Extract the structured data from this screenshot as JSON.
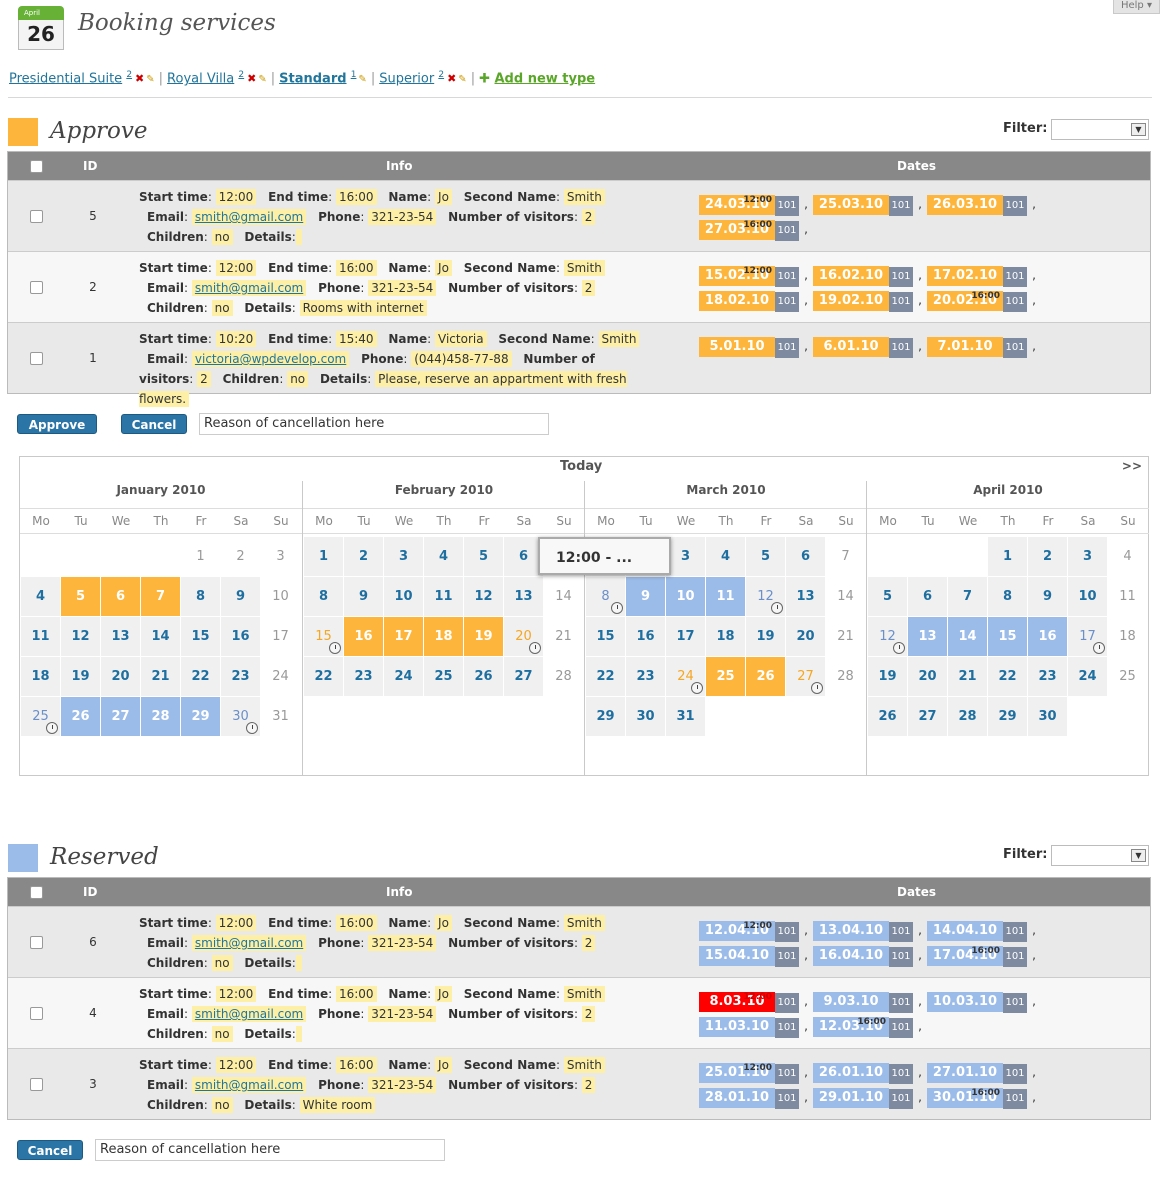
{
  "help": "Help",
  "header": {
    "logo_month": "April",
    "logo_day": "26",
    "title": "Booking services"
  },
  "types": [
    {
      "label": "Presidential Suite",
      "count": "2",
      "x": "✖",
      "pen": "✎",
      "active": false
    },
    {
      "label": "Royal Villa",
      "count": "2",
      "x": "✖",
      "pen": "✎",
      "active": false
    },
    {
      "label": "Standard",
      "count": "1",
      "x": "",
      "pen": "✎",
      "active": true
    },
    {
      "label": "Superior",
      "count": "2",
      "x": "✖",
      "pen": "✎",
      "active": false
    }
  ],
  "add_type": "Add new type",
  "approve_section": {
    "title": "Approve",
    "color": "#fdb53c",
    "filter_label": "Filter:",
    "headers": {
      "id": "ID",
      "info": "Info",
      "dates": "Dates"
    },
    "rows": [
      {
        "id": "5",
        "start": "12:00",
        "end": "16:00",
        "name": "Jo",
        "second_name": "Smith",
        "email": "smith@gmail.com",
        "phone": "321-23-54",
        "visitors": "2",
        "children": "no",
        "details": "",
        "dates": [
          {
            "d": "24.03.10",
            "t": "12:00",
            "r": "101"
          },
          {
            "d": "25.03.10",
            "t": "",
            "r": "101"
          },
          {
            "d": "26.03.10",
            "t": "",
            "r": "101"
          },
          {
            "d": "27.03.10",
            "t": "16:00",
            "r": "101"
          }
        ]
      },
      {
        "id": "2",
        "start": "12:00",
        "end": "16:00",
        "name": "Jo",
        "second_name": "Smith",
        "email": "smith@gmail.com",
        "phone": "321-23-54",
        "visitors": "2",
        "children": "no",
        "details": "Rooms with internet",
        "dates": [
          {
            "d": "15.02.10",
            "t": "12:00",
            "r": "101"
          },
          {
            "d": "16.02.10",
            "t": "",
            "r": "101"
          },
          {
            "d": "17.02.10",
            "t": "",
            "r": "101"
          },
          {
            "d": "18.02.10",
            "t": "",
            "r": "101"
          },
          {
            "d": "19.02.10",
            "t": "",
            "r": "101"
          },
          {
            "d": "20.02.10",
            "t": "16:00",
            "r": "101"
          }
        ]
      },
      {
        "id": "1",
        "start": "10:20",
        "end": "15:40",
        "name": "Victoria",
        "second_name": "Smith",
        "email": "victoria@wpdevelop.com",
        "phone": "(044)458-77-88",
        "visitors": "2",
        "children": "no",
        "details": "Please, reserve an appartment with fresh flowers.",
        "dates": [
          {
            "d": "5.01.10",
            "t": "",
            "r": "101"
          },
          {
            "d": "6.01.10",
            "t": "",
            "r": "101"
          },
          {
            "d": "7.01.10",
            "t": "",
            "r": "101"
          }
        ]
      }
    ],
    "approve_button": "Approve",
    "cancel_button": "Cancel",
    "reason": "Reason of cancellation here"
  },
  "labels": {
    "start": "Start time",
    "end": "End time",
    "name": "Name",
    "second_name": "Second Name",
    "email": "Email",
    "phone": "Phone",
    "visitors": "Number of visitors",
    "children": "Children",
    "details": "Details"
  },
  "calendar": {
    "today": "Today",
    "next": ">>",
    "dow": [
      "Mo",
      "Tu",
      "We",
      "Th",
      "Fr",
      "Sa",
      "Su"
    ],
    "months": [
      {
        "title": "January 2010",
        "offset": 4,
        "days": 31,
        "orange": [
          5,
          6,
          7
        ],
        "blue": [
          26,
          27,
          28,
          29
        ],
        "half_orange": [],
        "half_blue": [
          25,
          30
        ],
        "dim": [
          1,
          2,
          3,
          10,
          17,
          24,
          31
        ]
      },
      {
        "title": "February 2010",
        "offset": 0,
        "days": 28,
        "orange": [
          16,
          17,
          18,
          19
        ],
        "blue": [],
        "half_orange": [
          15,
          20
        ],
        "half_blue": [],
        "dim": [
          7,
          14,
          21,
          28
        ]
      },
      {
        "title": "March 2010",
        "offset": 0,
        "days": 31,
        "orange": [
          25,
          26
        ],
        "blue": [
          9,
          10,
          11
        ],
        "half_orange": [
          24,
          27
        ],
        "half_blue": [
          8,
          12
        ],
        "dim": [
          7,
          14,
          21,
          28
        ]
      },
      {
        "title": "April 2010",
        "offset": 3,
        "days": 30,
        "orange": [],
        "blue": [
          13,
          14,
          15,
          16
        ],
        "half_orange": [],
        "half_blue": [
          12,
          17
        ],
        "dim": [
          4,
          11,
          18,
          25
        ]
      }
    ],
    "tooltip": "12:00 -      ..."
  },
  "reserved_section": {
    "title": "Reserved",
    "color": "#9bbbe8",
    "filter_label": "Filter:",
    "headers": {
      "id": "ID",
      "info": "Info",
      "dates": "Dates"
    },
    "rows": [
      {
        "id": "6",
        "start": "12:00",
        "end": "16:00",
        "name": "Jo",
        "second_name": "Smith",
        "email": "smith@gmail.com",
        "phone": "321-23-54",
        "visitors": "2",
        "children": "no",
        "details": "",
        "dates": [
          {
            "d": "12.04.10",
            "t": "12:00",
            "r": "101"
          },
          {
            "d": "13.04.10",
            "t": "",
            "r": "101"
          },
          {
            "d": "14.04.10",
            "t": "",
            "r": "101"
          },
          {
            "d": "15.04.10",
            "t": "",
            "r": "101"
          },
          {
            "d": "16.04.10",
            "t": "",
            "r": "101"
          },
          {
            "d": "17.04.10",
            "t": "16:00",
            "r": "101"
          }
        ]
      },
      {
        "id": "4",
        "start": "12:00",
        "end": "16:00",
        "name": "Jo",
        "second_name": "Smith",
        "email": "smith@gmail.com",
        "phone": "321-23-54",
        "visitors": "2",
        "children": "no",
        "details": "",
        "dates": [
          {
            "d": "8.03.10",
            "t": "12:00",
            "r": "101",
            "red": true
          },
          {
            "d": "9.03.10",
            "t": "",
            "r": "101"
          },
          {
            "d": "10.03.10",
            "t": "",
            "r": "101"
          },
          {
            "d": "11.03.10",
            "t": "",
            "r": "101"
          },
          {
            "d": "12.03.10",
            "t": "16:00",
            "r": "101"
          }
        ]
      },
      {
        "id": "3",
        "start": "12:00",
        "end": "16:00",
        "name": "Jo",
        "second_name": "Smith",
        "email": "smith@gmail.com",
        "phone": "321-23-54",
        "visitors": "2",
        "children": "no",
        "details": "White room",
        "dates": [
          {
            "d": "25.01.10",
            "t": "12:00",
            "r": "101"
          },
          {
            "d": "26.01.10",
            "t": "",
            "r": "101"
          },
          {
            "d": "27.01.10",
            "t": "",
            "r": "101"
          },
          {
            "d": "28.01.10",
            "t": "",
            "r": "101"
          },
          {
            "d": "29.01.10",
            "t": "",
            "r": "101"
          },
          {
            "d": "30.01.10",
            "t": "16:00",
            "r": "101"
          }
        ]
      }
    ],
    "cancel_button": "Cancel",
    "reason": "Reason of cancellation here"
  }
}
